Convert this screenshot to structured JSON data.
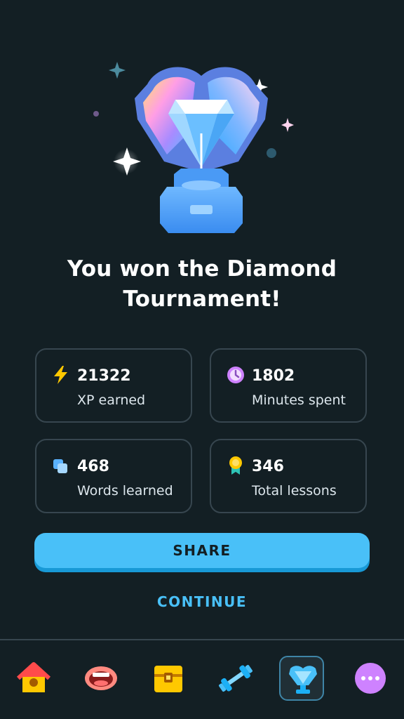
{
  "title": "You won the Diamond Tournament!",
  "stats": [
    {
      "value": "21322",
      "label": "XP earned",
      "icon": "lightning-icon"
    },
    {
      "value": "1802",
      "label": "Minutes spent",
      "icon": "clock-icon"
    },
    {
      "value": "468",
      "label": "Words learned",
      "icon": "cards-icon"
    },
    {
      "value": "346",
      "label": "Total lessons",
      "icon": "medal-icon"
    }
  ],
  "buttons": {
    "share": "SHARE",
    "continue": "CONTINUE"
  },
  "tabs": [
    {
      "name": "home",
      "icon": "home-icon",
      "active": false
    },
    {
      "name": "speaking",
      "icon": "mouth-icon",
      "active": false
    },
    {
      "name": "shop",
      "icon": "treasure-chest-icon",
      "active": false
    },
    {
      "name": "practice",
      "icon": "dumbbell-icon",
      "active": false
    },
    {
      "name": "leaderboards",
      "icon": "trophy-icon",
      "active": true
    },
    {
      "name": "more",
      "icon": "more-icon",
      "active": false
    }
  ],
  "colors": {
    "background": "#131f24",
    "card_border": "#37464f",
    "accent": "#49c0f8",
    "accent_shadow": "#1899d6"
  }
}
